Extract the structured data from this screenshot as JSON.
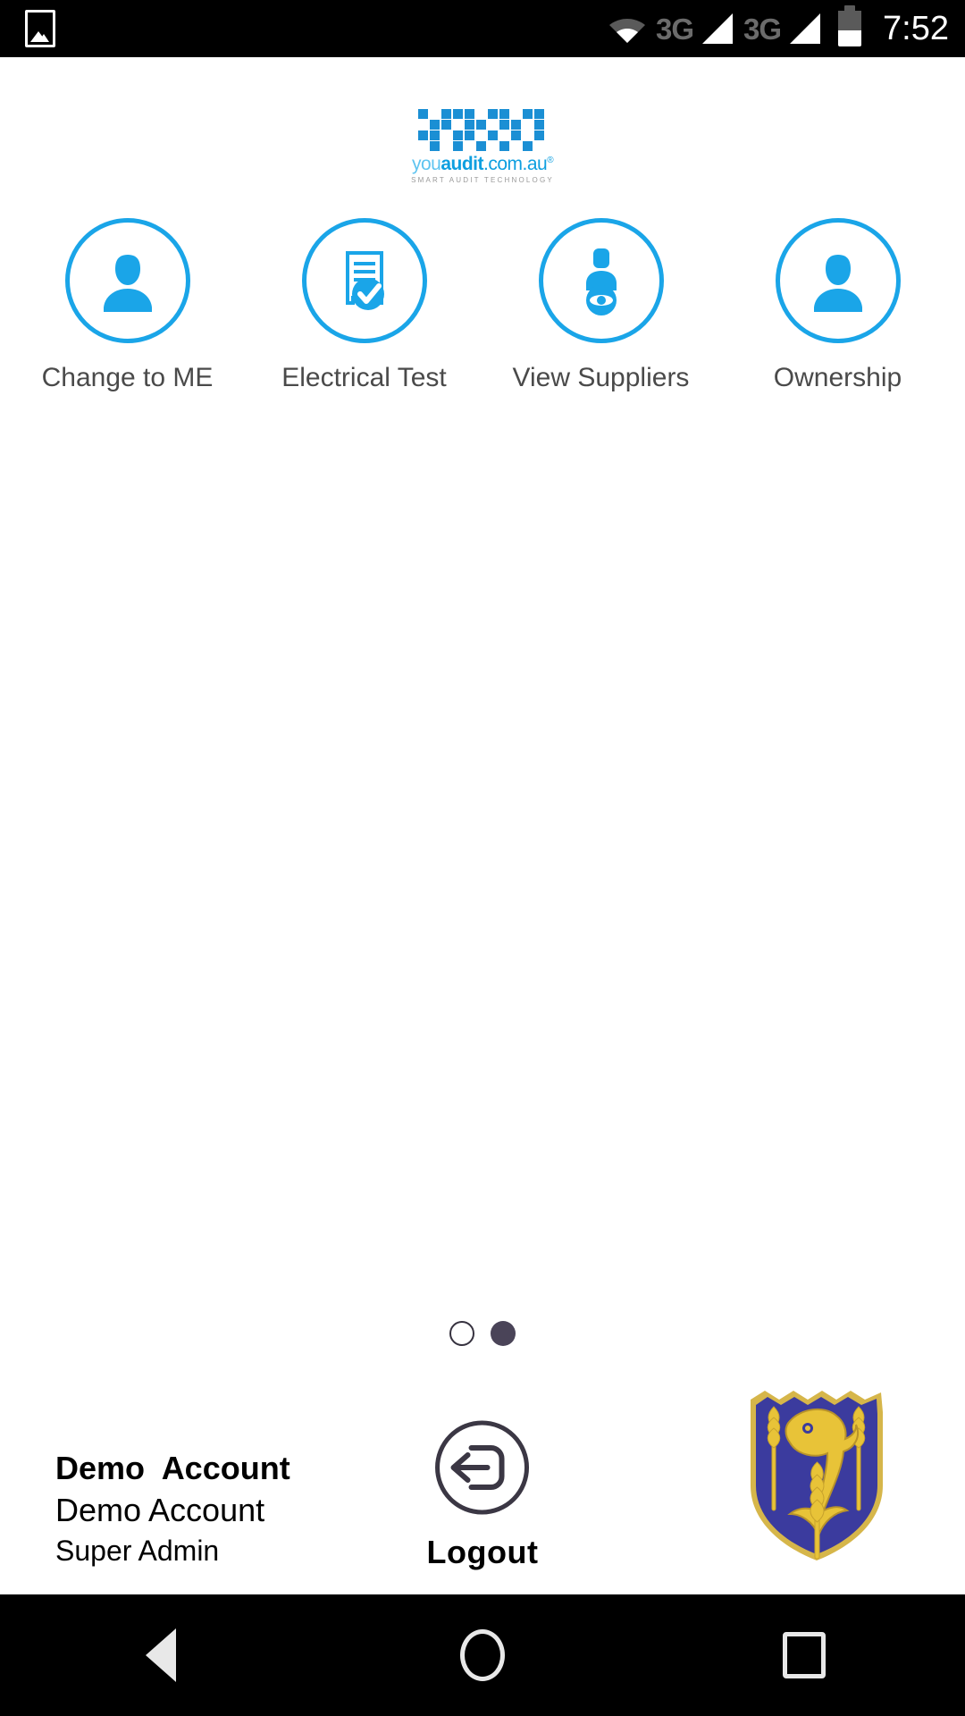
{
  "status_bar": {
    "gallery_icon": "image-icon",
    "wifi_icon": "wifi-icon",
    "sim1_network": "3G",
    "sim1_signal_icon": "signal-bars-icon",
    "sim2_network": "3G",
    "sim2_signal_icon": "signal-bars-icon",
    "battery_icon": "battery-icon",
    "battery_level_pct": 45,
    "time": "7:52"
  },
  "logo": {
    "blocks_icon": "qr-blocks-logo-icon",
    "word_you": "you",
    "word_audit": "audit",
    "word_domain": ".com.au",
    "registered_mark": "®",
    "tagline": "SMART AUDIT TECHNOLOGY"
  },
  "menu": {
    "items": [
      {
        "label": "Change to ME",
        "icon": "person-icon"
      },
      {
        "label": "Electrical Test",
        "icon": "document-check-icon"
      },
      {
        "label": "View Suppliers",
        "icon": "person-eye-icon"
      },
      {
        "label": "Ownership",
        "icon": "person-icon"
      }
    ]
  },
  "pagination": {
    "dots": [
      {
        "state": "inactive"
      },
      {
        "state": "active"
      }
    ],
    "current_page": 2,
    "total_pages": 2
  },
  "footer": {
    "account_name": "Demo  Account",
    "account_company": "Demo Account",
    "account_role": "Super Admin",
    "logout_label": "Logout",
    "logout_icon": "logout-arrow-icon",
    "crest_icon": "shield-crest-icon"
  },
  "nav_bar": {
    "back_label": "Back",
    "back_icon": "triangle-back-icon",
    "home_label": "Home",
    "home_icon": "circle-home-icon",
    "recents_label": "Recents",
    "recents_icon": "square-recents-icon"
  },
  "colors": {
    "accent_blue": "#1aa5e8",
    "logo_blue": "#0e9fe0",
    "label_gray": "#4a4a4a",
    "dot_active": "#4a4458",
    "crest_blue": "#3b3b9e",
    "crest_gold": "#e8c338",
    "status_bg": "#000000"
  }
}
